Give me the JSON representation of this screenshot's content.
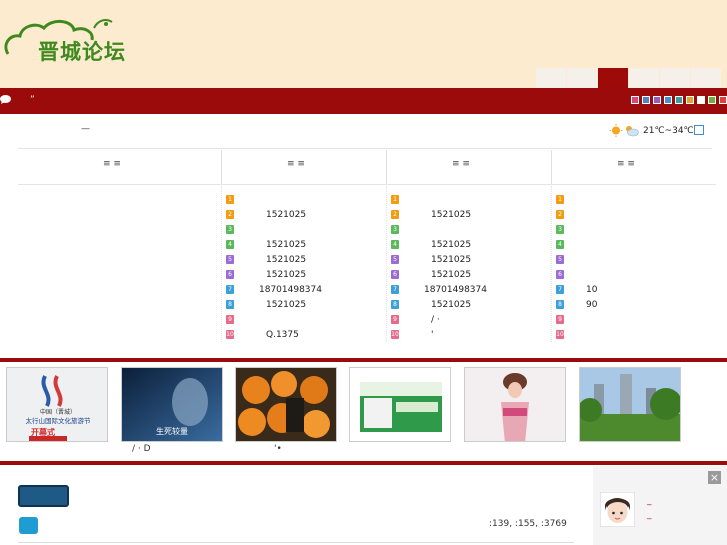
{
  "site": {
    "logo_text": "晋城论坛"
  },
  "nav": {
    "tabs": [
      "",
      "",
      "",
      "",
      "",
      ""
    ],
    "active_index": 2
  },
  "topbar": {
    "text": "”",
    "swatches": [
      "#d9477a",
      "#5a7fc2",
      "#9a5ab7",
      "#4a8fcf",
      "#3a9ea0",
      "#e9a12d",
      "#ffffff",
      "#7aaa3a",
      "#e53e3e"
    ]
  },
  "weather": {
    "text": "21℃~34℃"
  },
  "dash": "—",
  "columns": [
    {
      "header": "≡     ≡",
      "rows": [
        {
          "n": "1",
          "c": "#f39c12",
          "t": ""
        },
        {
          "n": "2",
          "c": "#f39c12",
          "t": "1521025"
        },
        {
          "n": "3",
          "c": "#5cb85c",
          "t": ""
        },
        {
          "n": "4",
          "c": "#5cb85c",
          "t": "1521025"
        },
        {
          "n": "5",
          "c": "#9b6bd6",
          "t": "1521025"
        },
        {
          "n": "6",
          "c": "#9b6bd6",
          "t": "1521025"
        },
        {
          "n": "7",
          "c": "#3ba0d9",
          "t": "18701498374"
        },
        {
          "n": "8",
          "c": "#3ba0d9",
          "t": "1521025"
        },
        {
          "n": "9",
          "c": "#e56b8c",
          "t": ""
        },
        {
          "n": "10",
          "c": "#e56b8c",
          "t": "Q.1375"
        }
      ]
    },
    {
      "header": "≡     ≡",
      "rows": [
        {
          "n": "1",
          "c": "#f39c12",
          "t": ""
        },
        {
          "n": "2",
          "c": "#f39c12",
          "t": "1521025"
        },
        {
          "n": "3",
          "c": "#5cb85c",
          "t": ""
        },
        {
          "n": "4",
          "c": "#5cb85c",
          "t": "1521025"
        },
        {
          "n": "5",
          "c": "#9b6bd6",
          "t": "1521025"
        },
        {
          "n": "6",
          "c": "#9b6bd6",
          "t": "1521025"
        },
        {
          "n": "7",
          "c": "#3ba0d9",
          "t": "18701498374"
        },
        {
          "n": "8",
          "c": "#3ba0d9",
          "t": "1521025"
        },
        {
          "n": "9",
          "c": "#e56b8c",
          "t": "/    ·"
        },
        {
          "n": "10",
          "c": "#e56b8c",
          "t": "'"
        }
      ]
    },
    {
      "header": "≡     ≡",
      "rows": [
        {
          "n": "1",
          "c": "#f39c12",
          "t": ""
        },
        {
          "n": "2",
          "c": "#f39c12",
          "t": ""
        },
        {
          "n": "3",
          "c": "#5cb85c",
          "t": ""
        },
        {
          "n": "4",
          "c": "#5cb85c",
          "t": ""
        },
        {
          "n": "5",
          "c": "#9b6bd6",
          "t": ""
        },
        {
          "n": "6",
          "c": "#9b6bd6",
          "t": ""
        },
        {
          "n": "7",
          "c": "#3ba0d9",
          "t": "10"
        },
        {
          "n": "8",
          "c": "#3ba0d9",
          "t": "90"
        },
        {
          "n": "9",
          "c": "#e56b8c",
          "t": ""
        },
        {
          "n": "10",
          "c": "#e56b8c",
          "t": ""
        }
      ]
    }
  ],
  "left_header": "≡     ≡",
  "photos": [
    {
      "caption": "",
      "poster_title": "太行山国际文化旅游节",
      "poster_sub": "开幕式"
    },
    {
      "caption": "/    ·       D",
      "poster_title": "生死较量"
    },
    {
      "caption": "'•",
      "poster_title": ""
    },
    {
      "caption": "",
      "poster_title": ""
    },
    {
      "caption": "",
      "poster_title": ""
    },
    {
      "caption": "",
      "poster_title": ""
    }
  ],
  "stats": ":139,  :155,  :3769",
  "sidebar": {
    "close_label": "×",
    "dash1": "_",
    "dash2": "_"
  }
}
